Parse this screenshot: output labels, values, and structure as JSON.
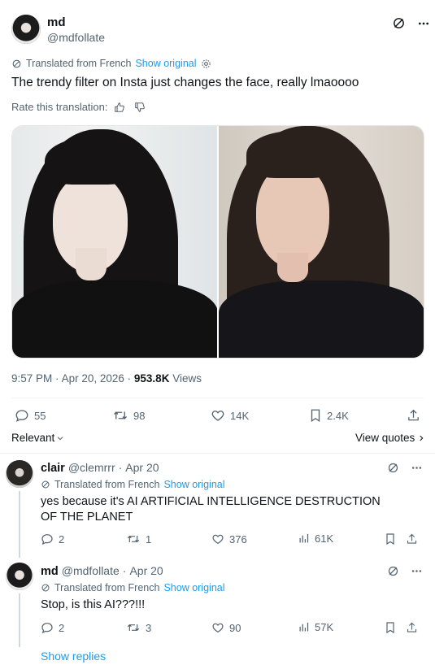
{
  "tweet": {
    "author_name": "md",
    "author_handle": "@mdfollate",
    "translated_label": "Translated from French",
    "show_original": "Show original",
    "text": "The trendy filter on Insta just changes the face, really lmaoooo",
    "rate_label": "Rate this translation:",
    "time": "9:57 PM",
    "date": "Apr 20, 2026",
    "views_count": "953.8K",
    "views_label": "Views",
    "actions": {
      "replies": "55",
      "reposts": "98",
      "likes": "14K",
      "bookmarks": "2.4K"
    }
  },
  "sort": {
    "relevant": "Relevant",
    "view_quotes": "View quotes"
  },
  "replies": [
    {
      "name": "clair",
      "handle": "@clemrrr",
      "date": "Apr 20",
      "translated_label": "Translated from French",
      "show_original": "Show original",
      "text": "yes because it's AI ARTIFICIAL INTELLIGENCE DESTRUCTION OF THE PLANET",
      "replies": "2",
      "reposts": "1",
      "likes": "376",
      "views": "61K"
    },
    {
      "name": "md",
      "handle": "@mdfollate",
      "date": "Apr 20",
      "translated_label": "Translated from French",
      "show_original": "Show original",
      "text": "Stop, is this AI???!!!",
      "replies": "2",
      "reposts": "3",
      "likes": "90",
      "views": "57K"
    }
  ],
  "show_replies": "Show replies",
  "sep": "·",
  "colors": {
    "link": "#1d9bf0",
    "muted": "#536471",
    "text": "#0f1419"
  }
}
